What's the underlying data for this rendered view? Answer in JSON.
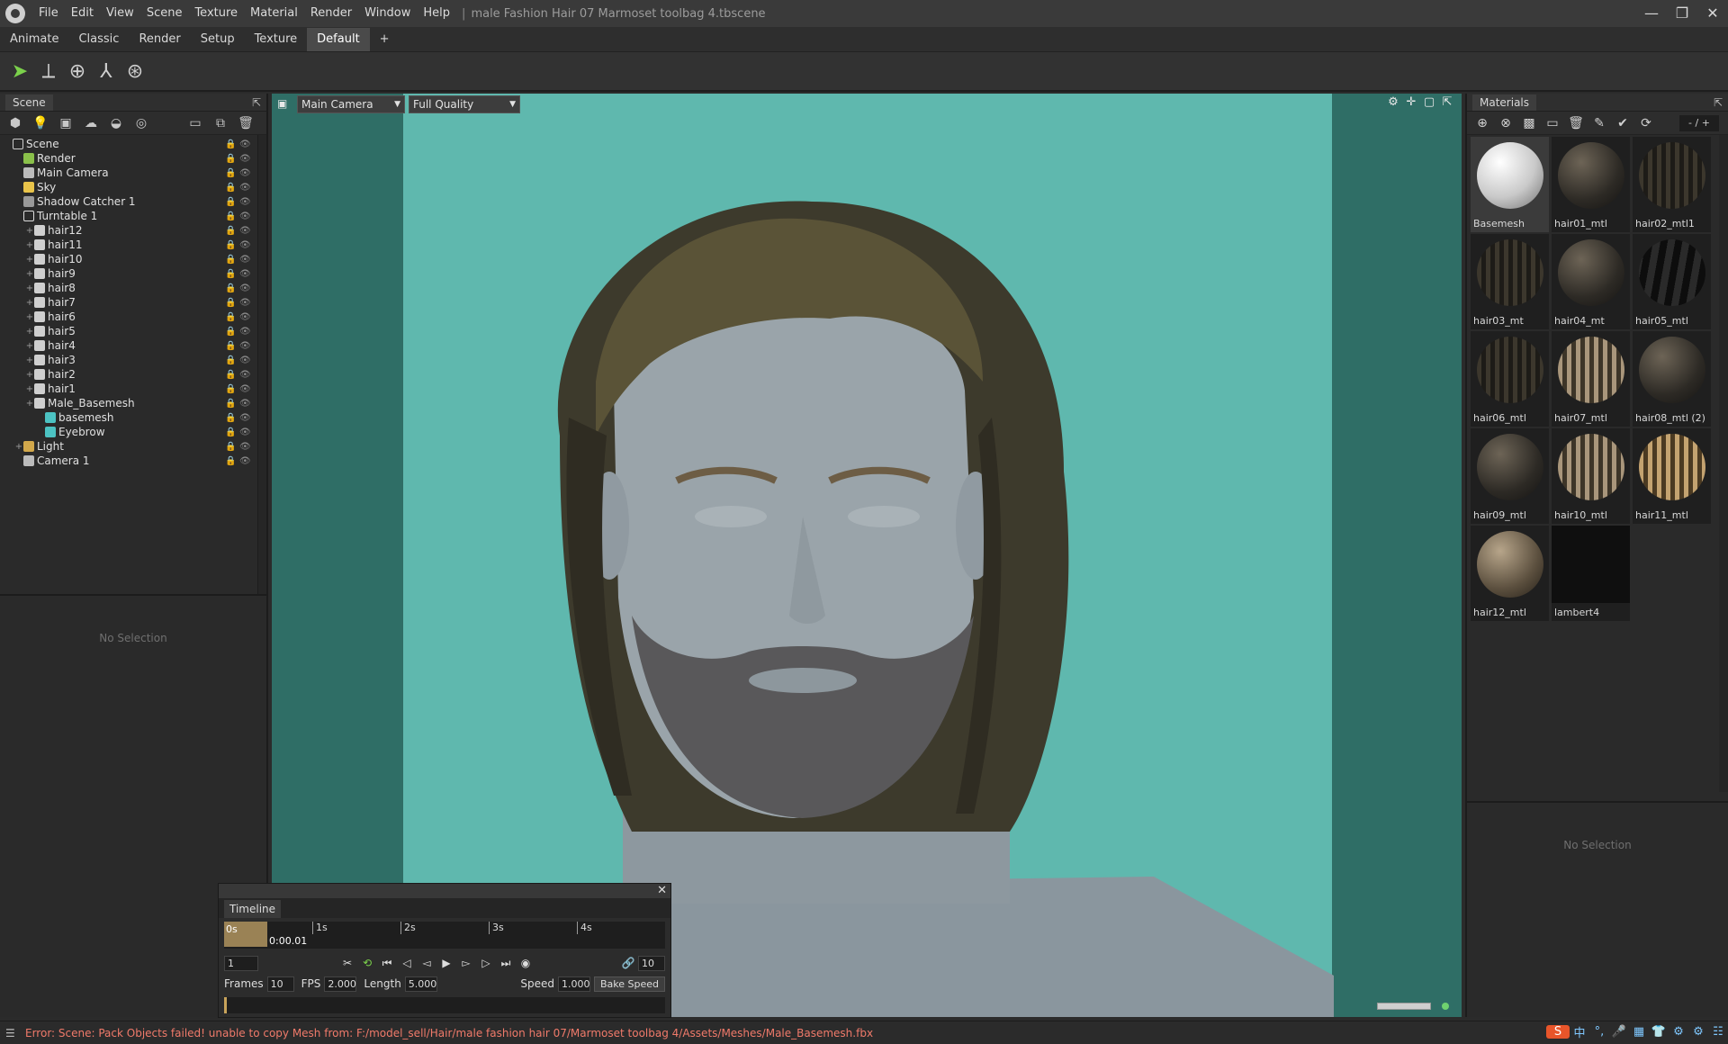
{
  "menubar": {
    "items": [
      "File",
      "Edit",
      "View",
      "Scene",
      "Texture",
      "Material",
      "Render",
      "Window",
      "Help"
    ],
    "separator": "|",
    "title": "male Fashion Hair 07 Marmoset toolbag 4.tbscene",
    "win_minimize": "—",
    "win_restore": "❐",
    "win_close": "✕"
  },
  "layout_tabs": [
    "Animate",
    "Classic",
    "Render",
    "Setup",
    "Texture",
    "Default",
    "+"
  ],
  "active_layout": "Default",
  "scene": {
    "title": "Scene",
    "tree": [
      {
        "label": "Scene",
        "depth": 0,
        "icon": "scene-icon"
      },
      {
        "label": "Render",
        "depth": 1,
        "icon": "render-icon"
      },
      {
        "label": "Main Camera",
        "depth": 1,
        "icon": "camera-icon"
      },
      {
        "label": "Sky",
        "depth": 1,
        "icon": "sky-icon"
      },
      {
        "label": "Shadow Catcher 1",
        "depth": 1,
        "icon": "shadow-catcher-icon"
      },
      {
        "label": "Turntable 1",
        "depth": 1,
        "icon": "turntable-icon"
      },
      {
        "label": "hair12",
        "depth": 2,
        "icon": "mesh-icon"
      },
      {
        "label": "hair11",
        "depth": 2,
        "icon": "mesh-icon"
      },
      {
        "label": "hair10",
        "depth": 2,
        "icon": "mesh-icon"
      },
      {
        "label": "hair9",
        "depth": 2,
        "icon": "mesh-icon"
      },
      {
        "label": "hair8",
        "depth": 2,
        "icon": "mesh-icon"
      },
      {
        "label": "hair7",
        "depth": 2,
        "icon": "mesh-icon"
      },
      {
        "label": "hair6",
        "depth": 2,
        "icon": "mesh-icon"
      },
      {
        "label": "hair5",
        "depth": 2,
        "icon": "mesh-icon"
      },
      {
        "label": "hair4",
        "depth": 2,
        "icon": "mesh-icon"
      },
      {
        "label": "hair3",
        "depth": 2,
        "icon": "mesh-icon"
      },
      {
        "label": "hair2",
        "depth": 2,
        "icon": "mesh-icon"
      },
      {
        "label": "hair1",
        "depth": 2,
        "icon": "mesh-icon"
      },
      {
        "label": "Male_Basemesh",
        "depth": 2,
        "icon": "mesh-icon"
      },
      {
        "label": "basemesh",
        "depth": 3,
        "icon": "cube-icon"
      },
      {
        "label": "Eyebrow",
        "depth": 3,
        "icon": "cube-icon"
      },
      {
        "label": "Light",
        "depth": 1,
        "icon": "folder-icon"
      },
      {
        "label": "Camera 1",
        "depth": 1,
        "icon": "camera-icon"
      }
    ],
    "no_selection": "No Selection"
  },
  "viewport": {
    "camera": "Main Camera",
    "quality": "Full Quality"
  },
  "timeline": {
    "tab": "Timeline",
    "ticks": [
      "0s",
      "1s",
      "2s",
      "3s",
      "4s"
    ],
    "current_time": "0:00.01",
    "frame": "1",
    "keyframe_step": "10",
    "frames_label": "Frames",
    "frames": "10",
    "fps_label": "FPS",
    "fps": "2.000",
    "length_label": "Length",
    "length": "5.000",
    "speed_label": "Speed",
    "speed": "1.000",
    "bake_label": "Bake Speed"
  },
  "materials": {
    "title": "Materials",
    "counter": "- / +",
    "items": [
      {
        "name": "Basemesh",
        "kind": "white"
      },
      {
        "name": "hair01_mtl",
        "kind": "dark-speck"
      },
      {
        "name": "hair02_mtl1",
        "kind": "dark-stripe"
      },
      {
        "name": "hair03_mt",
        "kind": "dark-stripe"
      },
      {
        "name": "hair04_mt",
        "kind": "dark-speck"
      },
      {
        "name": "hair05_mtl",
        "kind": "black-wave"
      },
      {
        "name": "hair06_mtl",
        "kind": "dark-stripe"
      },
      {
        "name": "hair07_mtl",
        "kind": "light-stripe"
      },
      {
        "name": "hair08_mtl (2)",
        "kind": "dark-speck"
      },
      {
        "name": "hair09_mtl",
        "kind": "dark-speck"
      },
      {
        "name": "hair10_mtl",
        "kind": "light-stripe"
      },
      {
        "name": "hair11_mtl",
        "kind": "gold-stripe"
      },
      {
        "name": "hair12_mtl",
        "kind": "light-speck"
      },
      {
        "name": "lambert4",
        "kind": "black"
      }
    ],
    "no_selection": "No Selection"
  },
  "status": {
    "message": "Error: Scene: Pack Objects failed! unable to copy Mesh from: F:/model_sell/Hair/male fashion hair 07/Marmoset toolbag 4/Assets/Meshes/Male_Basemesh.fbx"
  },
  "tray": {
    "ime": "S",
    "items": [
      "中",
      "°,",
      "🎤",
      "▦",
      "👕",
      "⚙",
      "⚙",
      "☷"
    ]
  },
  "colors": {
    "viewport_bg": "#5fb8ae",
    "viewport_dark": "#2f6e66",
    "accent_green": "#7bd14b",
    "error_text": "#f07a6a"
  }
}
